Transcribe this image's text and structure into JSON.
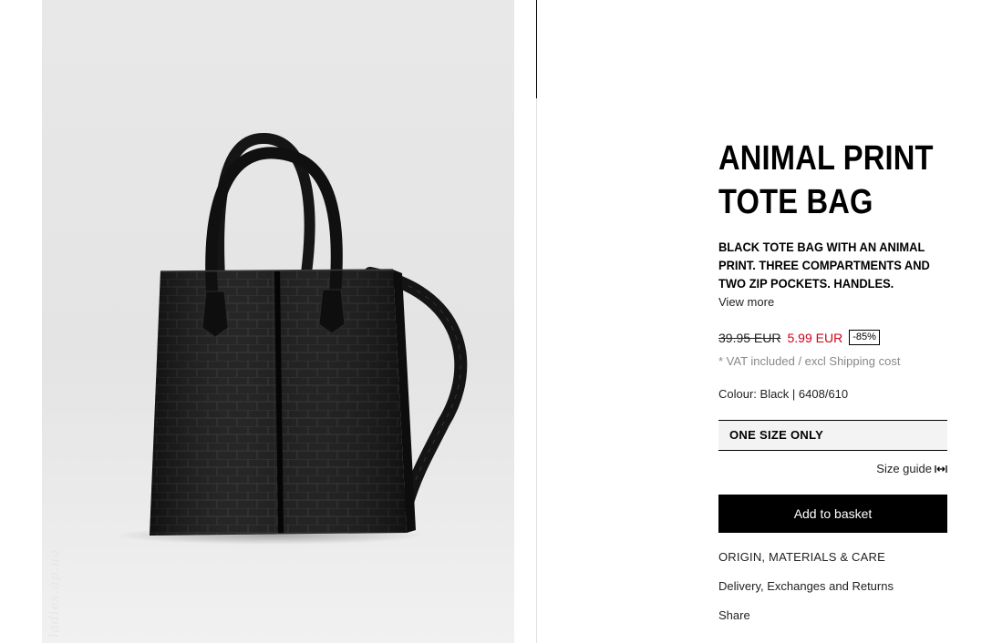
{
  "product": {
    "title_line1": "ANIMAL PRINT",
    "title_line2": "TOTE BAG",
    "description": "BLACK TOTE BAG WITH AN ANIMAL PRINT. THREE COMPARTMENTS AND TWO ZIP POCKETS. HANDLES.",
    "view_more": "View more",
    "old_price": "39.95 EUR",
    "new_price": "5.99 EUR",
    "discount": "-85%",
    "vat_note": "* VAT included / excl Shipping cost",
    "colour": "Colour: Black | 6408/610",
    "size": "ONE SIZE ONLY",
    "size_guide": "Size guide",
    "add_to_basket": "Add to basket"
  },
  "links": {
    "origin": "ORIGIN, MATERIALS & CARE",
    "delivery": "Delivery, Exchanges and Returns",
    "share": "Share"
  },
  "watermark": "ladies.ap.ua",
  "colors": {
    "accent_price": "#d0021b",
    "button_bg": "#000000",
    "photo_bg": "#e6e6e6"
  },
  "icons": {
    "size_guide": "ruler-arrows-icon"
  }
}
